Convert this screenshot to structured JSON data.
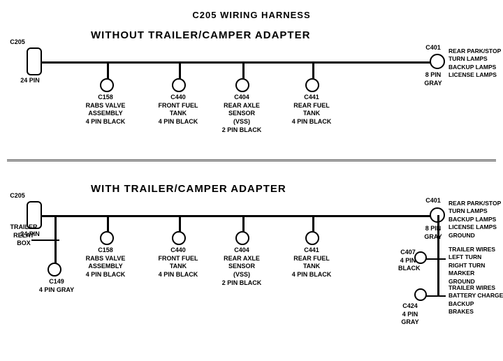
{
  "title": "C205 WIRING HARNESS",
  "section1": {
    "label": "WITHOUT  TRAILER/CAMPER  ADAPTER",
    "connectors": [
      {
        "id": "C205_top",
        "label": "C205\n24 PIN"
      },
      {
        "id": "C401_top",
        "label": "C401\n8 PIN\nGRAY"
      },
      {
        "id": "C158_top",
        "label": "C158\nRABS VALVE\nASSEMBLY\n4 PIN BLACK"
      },
      {
        "id": "C440_top",
        "label": "C440\nFRONT FUEL\nTANK\n4 PIN BLACK"
      },
      {
        "id": "C404_top",
        "label": "C404\nREAR AXLE\nSENSOR\n(VSS)\n2 PIN BLACK"
      },
      {
        "id": "C441_top",
        "label": "C441\nREAR FUEL\nTANK\n4 PIN BLACK"
      }
    ],
    "right_label": "REAR PARK/STOP\nTURN LAMPS\nBACKUP LAMPS\nLICENSE LAMPS"
  },
  "section2": {
    "label": "WITH  TRAILER/CAMPER  ADAPTER",
    "connectors": [
      {
        "id": "C205_bot",
        "label": "C205\n24 PIN"
      },
      {
        "id": "C401_bot",
        "label": "C401\n8 PIN\nGRAY"
      },
      {
        "id": "C158_bot",
        "label": "C158\nRABS VALVE\nASSEMBLY\n4 PIN BLACK"
      },
      {
        "id": "C440_bot",
        "label": "C440\nFRONT FUEL\nTANK\n4 PIN BLACK"
      },
      {
        "id": "C404_bot",
        "label": "C404\nREAR AXLE\nSENSOR\n(VSS)\n2 PIN BLACK"
      },
      {
        "id": "C441_bot",
        "label": "C441\nREAR FUEL\nTANK\n4 PIN BLACK"
      },
      {
        "id": "C149",
        "label": "C149\n4 PIN GRAY"
      },
      {
        "id": "C407",
        "label": "C407\n4 PIN\nBLACK"
      },
      {
        "id": "C424",
        "label": "C424\n4 PIN\nGRAY"
      }
    ],
    "trailer_relay": "TRAILER\nRELAY\nBOX",
    "right_labels": [
      "REAR PARK/STOP\nTURN LAMPS\nBACKUP LAMPS\nLICENSE LAMPS\nGROUND",
      "TRAILER WIRES\nLEFT TURN\nRIGHT TURN\nMARKER\nGROUND",
      "TRAILER WIRES\nBATTERY CHARGE\nBACKUP\nBRAKES"
    ]
  }
}
